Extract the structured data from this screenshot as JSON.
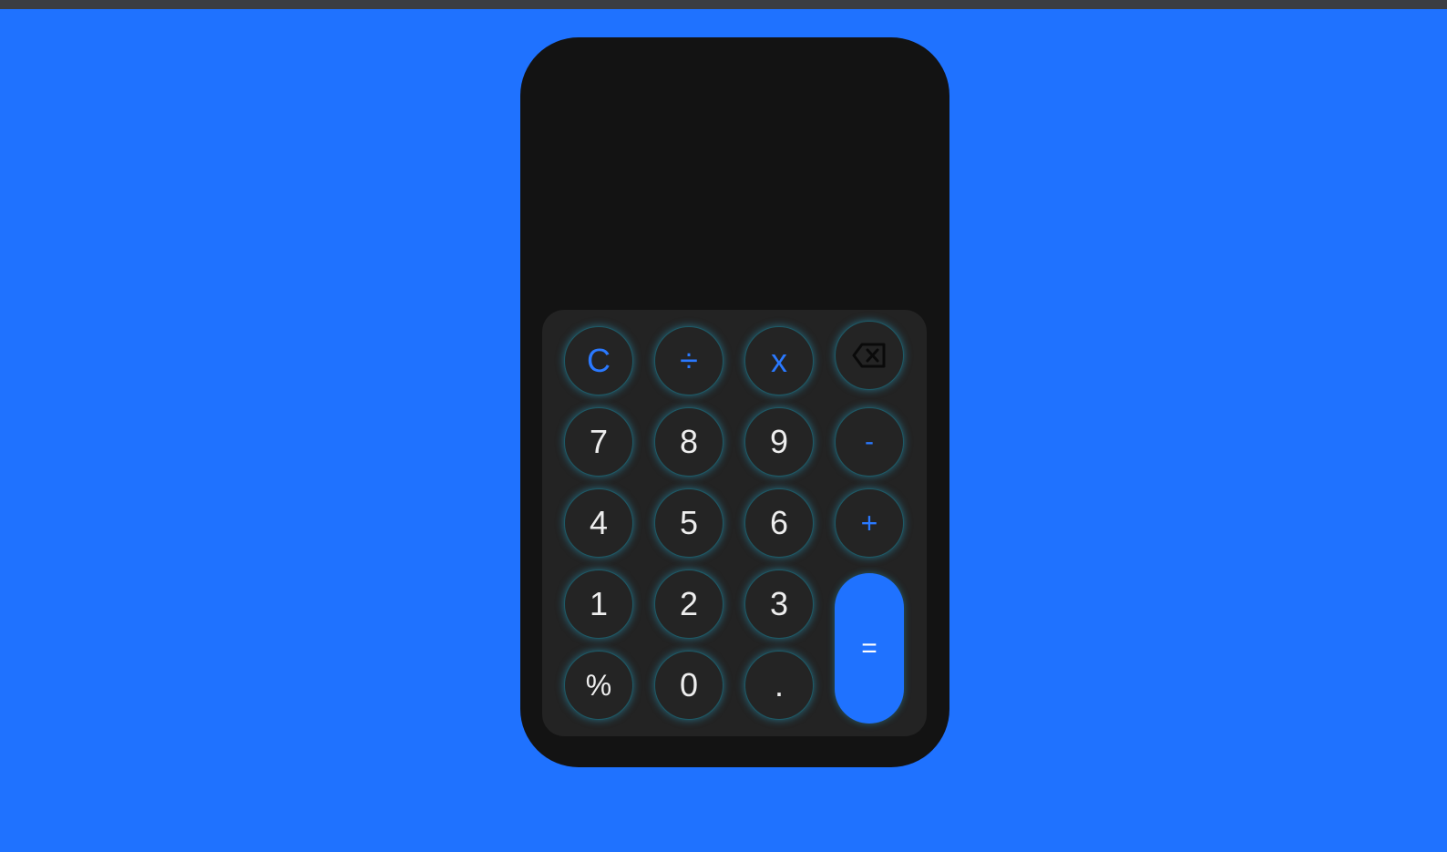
{
  "display": {
    "expression": "",
    "result": ""
  },
  "keys": {
    "clear": "C",
    "divide": "÷",
    "multiply": "x",
    "backspace_icon": "backspace-icon",
    "seven": "7",
    "eight": "8",
    "nine": "9",
    "minus": "-",
    "four": "4",
    "five": "5",
    "six": "6",
    "plus": "+",
    "one": "1",
    "two": "2",
    "three": "3",
    "equals": "=",
    "percent": "%",
    "zero": "0",
    "decimal": "."
  },
  "colors": {
    "background": "#1f72ff",
    "body": "#131313",
    "keypad": "#232323",
    "key": "#242424",
    "accent": "#2a79ff",
    "glow": "#28aad2"
  }
}
